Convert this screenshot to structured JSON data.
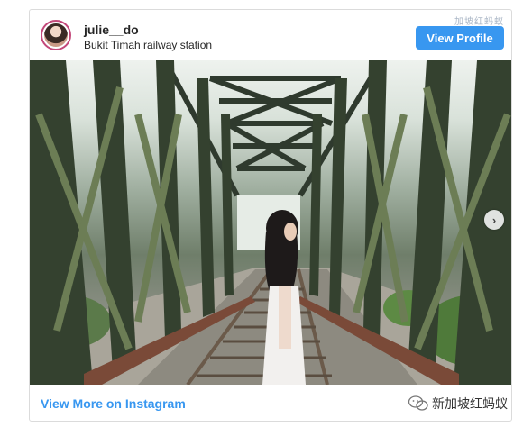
{
  "post": {
    "username": "julie__do",
    "location": "Bukit Timah railway station",
    "view_profile_label": "View Profile",
    "view_more_label": "View More on Instagram",
    "watermark_top": "加坡红蚂蚁",
    "wechat_account": "新加坡红蚂蚁"
  },
  "icons": {
    "avatar": "profile-picture",
    "next": "chevron-right-icon",
    "wechat": "wechat-logo-icon"
  },
  "colors": {
    "accent": "#3897f0",
    "avatar_ring": "#c3487a",
    "border": "#dbdbdb"
  }
}
